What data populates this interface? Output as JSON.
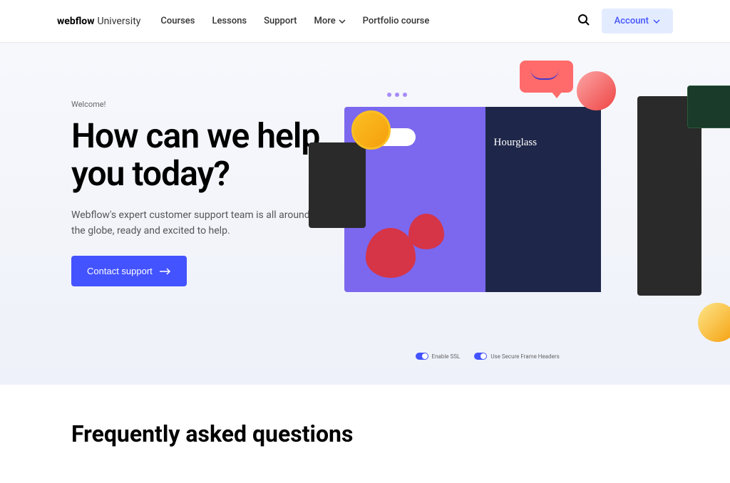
{
  "header": {
    "logo_bold": "webflow",
    "logo_light": "University",
    "nav": [
      "Courses",
      "Lessons",
      "Support",
      "More",
      "Portfolio course"
    ],
    "account": "Account"
  },
  "hero": {
    "welcome": "Welcome!",
    "title": "How can we help you today?",
    "subtitle": "Webflow's expert customer support team is all around the globe, ready and excited to help.",
    "cta": "Contact support",
    "mock_title": "Hourglass",
    "speech_question": "?",
    "toggle1": "Enable SSL",
    "toggle2": "Use Secure Frame Headers"
  },
  "faq": {
    "title": "Frequently asked questions"
  }
}
